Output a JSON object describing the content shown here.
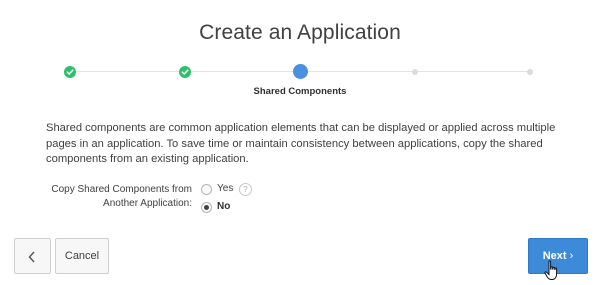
{
  "dialog": {
    "title": "Create an Application"
  },
  "train": {
    "steps": [
      {
        "state": "complete"
      },
      {
        "state": "complete"
      },
      {
        "state": "current",
        "label": "Shared Components"
      },
      {
        "state": "future"
      },
      {
        "state": "future"
      }
    ],
    "current_label": "Shared Components"
  },
  "content": {
    "description": "Shared components are common application elements that can be displayed or applied across multiple pages in an application. To save time or maintain consistency between applications, copy the shared components from an existing application.",
    "field_label": "Copy Shared Components from Another Application:",
    "options": [
      {
        "label": "Yes",
        "selected": false
      },
      {
        "label": "No",
        "selected": true
      }
    ],
    "help_icon": "question-circle-icon"
  },
  "footer": {
    "back_icon": "chevron-left-icon",
    "cancel_label": "Cancel",
    "next_label": "Next",
    "next_icon": "chevron-right-icon"
  },
  "colors": {
    "complete": "#2ebf6d",
    "current": "#4a90e2",
    "primary_button": "#3d8ad8"
  }
}
